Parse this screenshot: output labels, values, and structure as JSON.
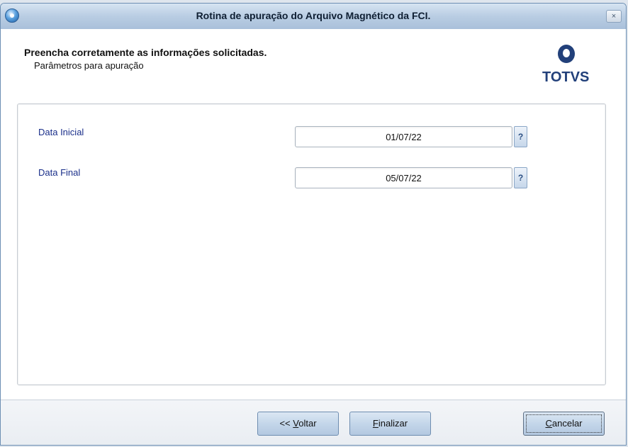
{
  "window": {
    "title": "Rotina de apuração do Arquivo Magnético da FCI.",
    "close_label": "×"
  },
  "header": {
    "heading": "Preencha corretamente as informações solicitadas.",
    "subheading": "Parâmetros para apuração",
    "logo_text": "TOTVS"
  },
  "fields": [
    {
      "label": "Data Inicial",
      "value": "01/07/22",
      "help": "?"
    },
    {
      "label": "Data Final",
      "value": "05/07/22",
      "help": "?"
    }
  ],
  "footer": {
    "back_prefix": "<< ",
    "back_hotkey": "V",
    "back_rest": "oltar",
    "finish_hotkey": "F",
    "finish_rest": "inalizar",
    "cancel_hotkey": "C",
    "cancel_rest": "ancelar"
  }
}
